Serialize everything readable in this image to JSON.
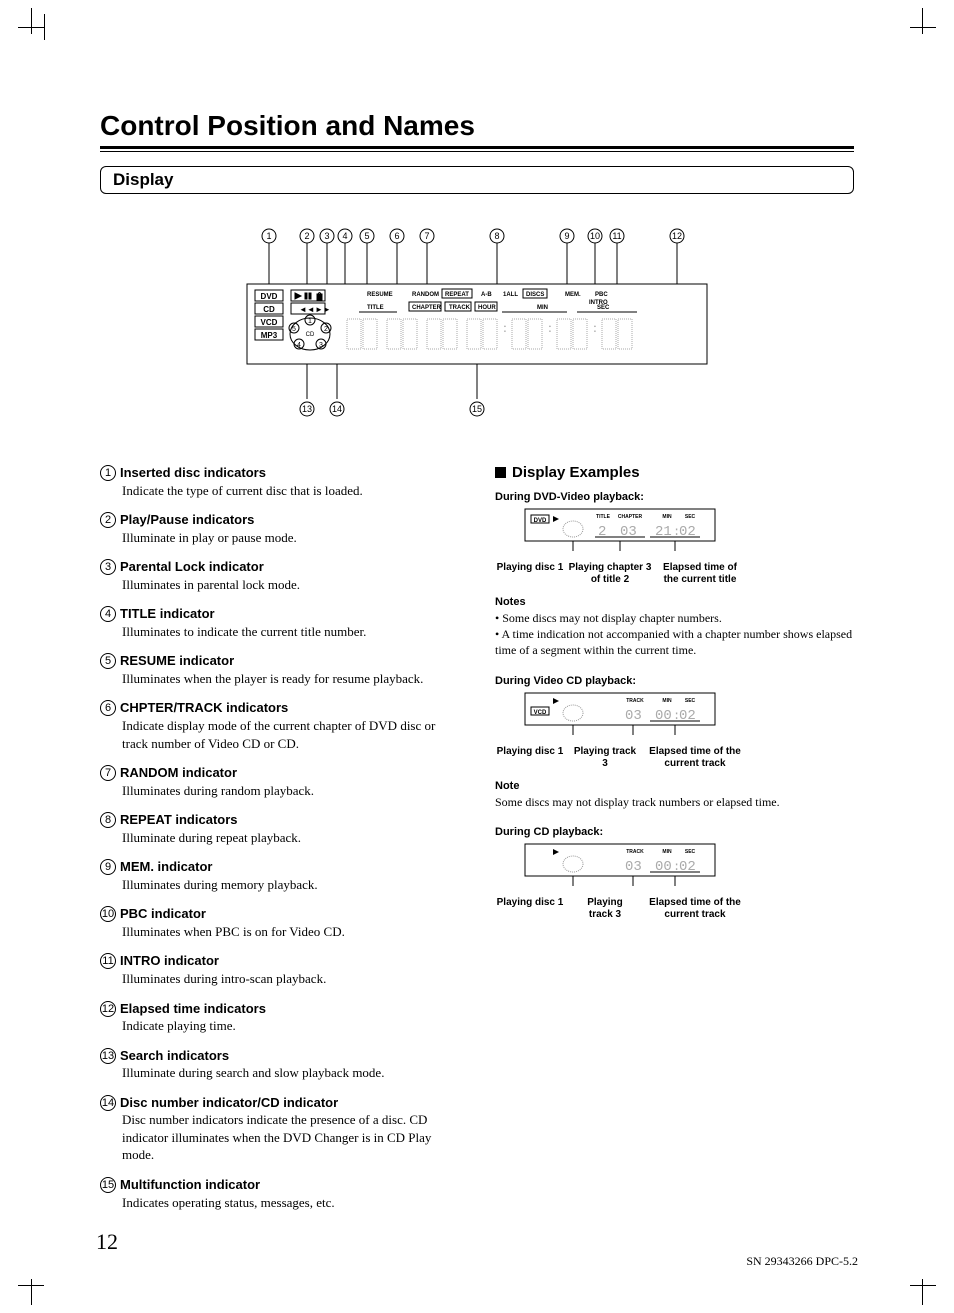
{
  "page": {
    "number": "12",
    "footer": "SN 29343266 DPC-5.2",
    "main_title": "Control Position and Names",
    "section_title": "Display"
  },
  "diagram": {
    "disc_types": [
      "DVD",
      "CD",
      "VCD",
      "MP3"
    ],
    "top_labels": [
      "RESUME",
      "RANDOM",
      "REPEAT",
      "A-B",
      "1ALL",
      "DISCS",
      "MEM.",
      "INTRO",
      "PBC"
    ],
    "sub_labels": [
      "TITLE",
      "CHAPTER",
      "TRACK",
      "HOUR",
      "MIN",
      "SEC"
    ],
    "disc_numbers": [
      "1",
      "2",
      "3",
      "4",
      "5"
    ],
    "cd_label": "CD",
    "callouts_top": [
      "1",
      "2",
      "3",
      "4",
      "5",
      "6",
      "7",
      "8",
      "9",
      "10",
      "11",
      "12"
    ],
    "callouts_bottom": [
      "13",
      "14",
      "15"
    ]
  },
  "items": [
    {
      "n": "1",
      "title": "Inserted disc indicators",
      "desc": "Indicate the type of current disc that is loaded."
    },
    {
      "n": "2",
      "title": "Play/Pause indicators",
      "desc": "Illuminate in play or pause mode."
    },
    {
      "n": "3",
      "title": "Parental Lock indicator",
      "desc": "Illuminates in parental lock mode."
    },
    {
      "n": "4",
      "title": "TITLE indicator",
      "desc": "Illuminates to indicate the current title number."
    },
    {
      "n": "5",
      "title": "RESUME indicator",
      "desc": "Illuminates when the player is ready for resume playback."
    },
    {
      "n": "6",
      "title": "CHPTER/TRACK indicators",
      "desc": "Indicate display mode of the current chapter of DVD disc or track number of Video CD or CD."
    },
    {
      "n": "7",
      "title": "RANDOM indicator",
      "desc": "Illuminates during random playback."
    },
    {
      "n": "8",
      "title": "REPEAT indicators",
      "desc": "Illuminate during repeat playback."
    },
    {
      "n": "9",
      "title": "MEM. indicator",
      "desc": "Illuminates during memory playback."
    },
    {
      "n": "10",
      "title": "PBC indicator",
      "desc": "Illuminates when PBC is on for Video CD."
    },
    {
      "n": "11",
      "title": "INTRO indicator",
      "desc": "Illuminates during intro-scan playback."
    },
    {
      "n": "12",
      "title": "Elapsed time indicators",
      "desc": "Indicate playing time."
    },
    {
      "n": "13",
      "title": "Search indicators",
      "desc": "Illuminate during search and slow playback mode."
    },
    {
      "n": "14",
      "title": "Disc number indicator/CD indicator",
      "desc": "Disc number indicators indicate the presence of a disc. CD indicator illuminates when the DVD Changer is in CD Play mode."
    },
    {
      "n": "15",
      "title": "Multifunction indicator",
      "desc": "Indicates operating status, messages, etc."
    }
  ],
  "examples": {
    "heading": "Display Examples",
    "dvd": {
      "label": "During DVD-Video playback:",
      "badge": "DVD",
      "fields": {
        "title": "TITLE",
        "chapter": "CHAPTER",
        "min": "MIN",
        "sec": "SEC"
      },
      "values": {
        "title": "2",
        "chapter": "03",
        "min": "21",
        "sec": "02"
      },
      "captions": [
        "Playing disc 1",
        "Playing chapter 3 of title 2",
        "Elapsed time of the current title"
      ],
      "notes_h": "Notes",
      "notes": [
        "Some discs may not display chapter numbers.",
        "A time indication not accompanied with a chapter number shows elapsed time of a segment within the current time."
      ]
    },
    "vcd": {
      "label": "During Video CD playback:",
      "badge": "VCD",
      "fields": {
        "track": "TRACK",
        "min": "MIN",
        "sec": "SEC"
      },
      "values": {
        "track": "03",
        "min": "00",
        "sec": "02"
      },
      "captions": [
        "Playing disc 1",
        "Playing track 3",
        "Elapsed time of the current track"
      ],
      "notes_h": "Note",
      "notes": [
        "Some discs may not display track numbers or elapsed time."
      ]
    },
    "cd": {
      "label": "During CD playback:",
      "fields": {
        "track": "TRACK",
        "min": "MIN",
        "sec": "SEC"
      },
      "values": {
        "track": "03",
        "min": "00",
        "sec": "02"
      },
      "captions": [
        "Playing disc 1",
        "Playing track 3",
        "Elapsed time of the current track"
      ]
    }
  }
}
